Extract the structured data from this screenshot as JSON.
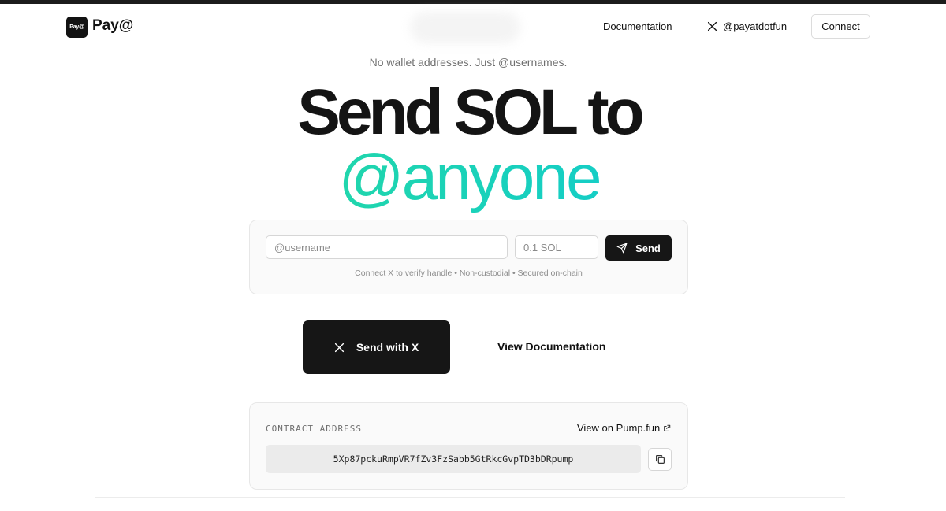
{
  "header": {
    "logo_text": "Pay@",
    "brand": "Pay@",
    "nav_documentation": "Documentation",
    "nav_x_handle": "@payatdotfun",
    "connect_label": "Connect"
  },
  "hero": {
    "tagline": "No wallet addresses. Just @usernames.",
    "title_line1": "Send SOL to",
    "title_line2": "@anyone",
    "gradient_colors": [
      "#2fe08b",
      "#18c6e2"
    ]
  },
  "send_form": {
    "username_placeholder": "@username",
    "amount_placeholder": "0.1 SOL",
    "send_label": "Send",
    "note": "Connect X to verify handle • Non-custodial • Secured on-chain"
  },
  "actions": {
    "send_with_x_label": "Send with X",
    "view_docs_label": "View Documentation"
  },
  "contract": {
    "label": "CONTRACT ADDRESS",
    "pump_link_label": "View on Pump.fun",
    "address": "5Xp87pckuRmpVR7fZv3FzSabb5GtRkcGvpTD3bDRpump"
  },
  "icons": {
    "x": "x-logo-icon",
    "send": "paper-plane-icon",
    "external": "external-link-icon",
    "copy": "copy-icon"
  },
  "colors": {
    "primary_dark": "#161616",
    "card_bg": "#fafafa",
    "accent_green": "#2fe08b",
    "accent_cyan": "#18c6e2"
  }
}
